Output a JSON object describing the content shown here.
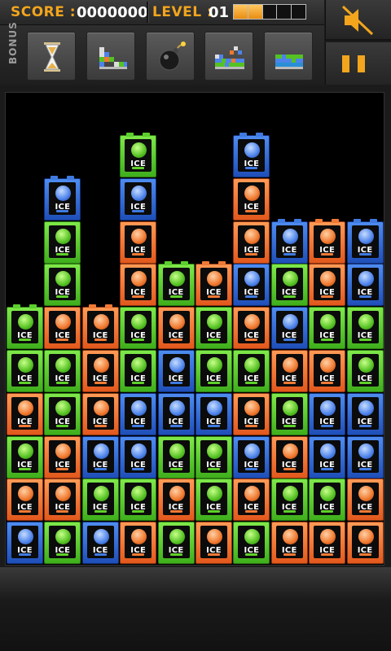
{
  "hud": {
    "score_label": "SCORE :",
    "score_value": "0000000",
    "level_label": "LEVEL :",
    "level_value": "01",
    "level_progress_segments": 5,
    "level_progress_filled": 2
  },
  "bonus": {
    "label": "BONUS",
    "items": [
      {
        "name": "hourglass-icon"
      },
      {
        "name": "tetris-blocks-icon"
      },
      {
        "name": "bomb-icon"
      },
      {
        "name": "mixed-blocks-icon"
      },
      {
        "name": "wall-blocks-icon"
      }
    ]
  },
  "controls": {
    "mute_icon": "speaker-muted-icon",
    "pause_icon": "pause-icon"
  },
  "colors": {
    "accent": "#f2a51d",
    "green": "#4fc423",
    "orange": "#f0782e",
    "blue": "#2f62cf"
  },
  "board": {
    "tile_label": "ICE",
    "columns": [
      [
        "blue",
        "orange",
        "green",
        "orange",
        "green",
        "green"
      ],
      [
        "green",
        "orange",
        "orange",
        "green",
        "green",
        "orange",
        "green",
        "green",
        "blue"
      ],
      [
        "blue",
        "green",
        "blue",
        "orange",
        "orange",
        "orange"
      ],
      [
        "orange",
        "green",
        "blue",
        "blue",
        "green",
        "green",
        "orange",
        "orange",
        "blue",
        "green"
      ],
      [
        "green",
        "orange",
        "green",
        "blue",
        "blue",
        "orange",
        "green"
      ],
      [
        "orange",
        "green",
        "green",
        "blue",
        "green",
        "green",
        "orange"
      ],
      [
        "green",
        "orange",
        "blue",
        "orange",
        "green",
        "orange",
        "blue",
        "orange",
        "orange",
        "blue"
      ],
      [
        "orange",
        "green",
        "orange",
        "green",
        "orange",
        "blue",
        "green",
        "blue"
      ],
      [
        "orange",
        "green",
        "blue",
        "blue",
        "orange",
        "green",
        "orange",
        "orange"
      ],
      [
        "orange",
        "orange",
        "blue",
        "blue",
        "green",
        "green",
        "blue",
        "blue"
      ]
    ]
  }
}
